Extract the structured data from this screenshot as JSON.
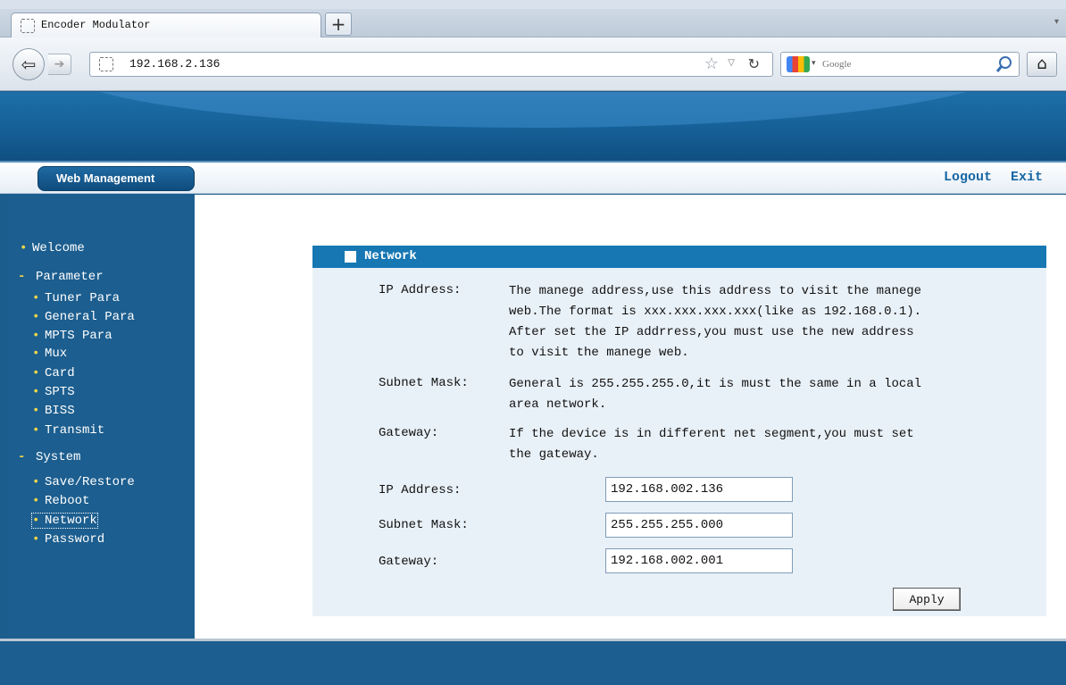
{
  "browser": {
    "tab_title": "Encoder Modulator",
    "new_tab_label": "+",
    "tab_list_label": "▾",
    "back_label": "⇦",
    "forward_label": "➔",
    "url": "192.168.2.136",
    "star_label": "☆",
    "dropdown_label": "▽",
    "reload_label": "↻",
    "search_engine_arrow": "▾",
    "search_placeholder": "Google",
    "home_label": "⌂"
  },
  "header": {
    "brand_tab": "Web Management",
    "logout": "Logout",
    "exit": "Exit"
  },
  "sidebar": {
    "bullet": "•",
    "dash": "-",
    "welcome": "Welcome",
    "parameter": "Parameter",
    "tuner_para": "Tuner Para",
    "general_para": "General Para",
    "mpts_para": "MPTS Para",
    "mux": "Mux",
    "card": "Card",
    "spts": "SPTS",
    "biss": "BISS",
    "transmit": "Transmit",
    "system": "System",
    "save_restore": "Save/Restore",
    "reboot": "Reboot",
    "network": "Network",
    "password": "Password"
  },
  "panel": {
    "title": "Network",
    "ip_desc_label": "IP Address:",
    "ip_desc_1": "The manege address,use this address to visit the manege",
    "ip_desc_2": "web.The format is xxx.xxx.xxx.xxx(like as 192.168.0.1).",
    "ip_desc_3": "After set the IP addrress,you must use the new address",
    "ip_desc_4": "to visit the manege web.",
    "mask_desc_label": "Subnet Mask:",
    "mask_desc_1": "General is 255.255.255.0,it is must the same in a local",
    "mask_desc_2": "area network.",
    "gw_desc_label": "Gateway:",
    "gw_desc_1": "If the device is in different net segment,you must set",
    "gw_desc_2": "the gateway.",
    "ip_label": "IP Address:",
    "ip_value": "192.168.002.136",
    "mask_label": "Subnet Mask:",
    "mask_value": "255.255.255.000",
    "gw_label": "Gateway:",
    "gw_value": "192.168.002.001",
    "apply_label": "Apply"
  },
  "colors": {
    "brand_blue": "#1677b3",
    "sidebar_bg": "#1c5e8f",
    "panel_bg": "#e9f1f8",
    "bullet_yellow": "#f2d64a"
  }
}
